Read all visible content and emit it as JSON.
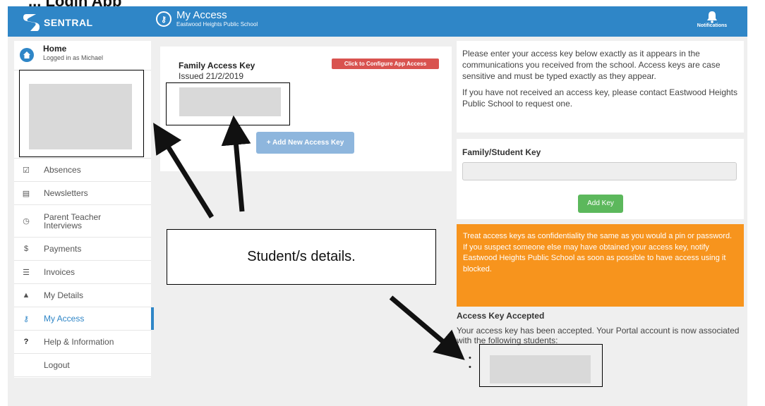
{
  "document_heading": "... Login App",
  "topbar": {
    "brand": "SENTRAL",
    "app_title": "My Access",
    "app_subtitle": "Eastwood Heights Public School",
    "notifications_label": "Notifications",
    "color": "#2f86c7"
  },
  "sidebar": {
    "home_title": "Home",
    "home_subtitle": "Logged in as Michael",
    "items": [
      {
        "label": "Absences",
        "icon": "check-square-icon"
      },
      {
        "label": "Newsletters",
        "icon": "newspaper-icon"
      },
      {
        "label": "Parent Teacher Interviews",
        "icon": "clock-icon"
      },
      {
        "label": "Payments",
        "icon": "dollar-icon"
      },
      {
        "label": "Invoices",
        "icon": "list-icon"
      },
      {
        "label": "My Details",
        "icon": "user-icon"
      },
      {
        "label": "My Access",
        "icon": "key-icon",
        "active": true
      },
      {
        "label": "Help & Information",
        "icon": "question-icon"
      },
      {
        "label": "Logout",
        "icon": ""
      }
    ]
  },
  "key_card": {
    "title": "Family Access Key",
    "issued": "Issued 21/2/2019",
    "config_button": "Click to Configure App Access",
    "add_button": "+ Add New Access Key"
  },
  "info": {
    "para1": "Please enter your access key below exactly as it appears in the communications you received from the school. Access keys are case sensitive and must be typed exactly as they appear.",
    "para2": "If you have not received an access key, please contact Eastwood Heights Public School to request one."
  },
  "key_entry": {
    "label": "Family/Student Key",
    "input_value": "",
    "button": "Add Key"
  },
  "warning": "Treat access keys as confidentiality the same as you would a pin or password. If you suspect someone else may have obtained your access key, notify Eastwood Heights Public School as soon as possible to have access using it blocked.",
  "accepted": {
    "title": "Access Key Accepted",
    "text": "Your access key has been accepted. Your Portal account is now associated with the following students:",
    "bullets": [
      "•",
      "•"
    ]
  },
  "annotation": {
    "callout": "Student/s details."
  },
  "colors": {
    "primary": "#2f86c7",
    "danger": "#d9534f",
    "success": "#5cb85c",
    "warning": "#f7941d"
  }
}
